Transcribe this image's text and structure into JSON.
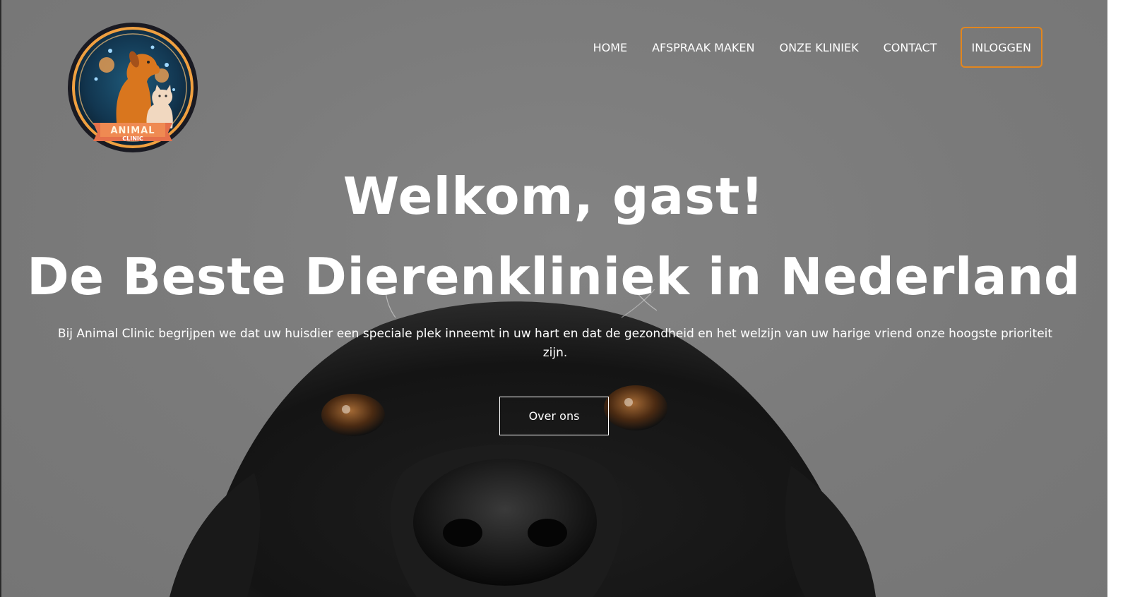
{
  "brand": {
    "logo_text_main": "ANIMAL",
    "logo_text_sub": "CLINIC"
  },
  "nav": {
    "items": [
      {
        "label": "HOME"
      },
      {
        "label": "AFSPRAAK MAKEN"
      },
      {
        "label": "ONZE KLINIEK"
      },
      {
        "label": "CONTACT"
      }
    ],
    "login_label": "INLOGGEN"
  },
  "hero": {
    "welcome": "Welkom, gast!",
    "headline": "De Beste Dierenkliniek in Nederland",
    "intro": "Bij Animal Clinic begrijpen we dat uw huisdier een speciale plek inneemt in uw hart en dat de gezondheid en het welzijn van uw harige vriend onze hoogste prioriteit zijn.",
    "button_label": "Over ons"
  },
  "colors": {
    "accent": "#e2861e",
    "overlay": "#7a7a7a",
    "text": "#ffffff"
  },
  "icons": {
    "logo": "animal-clinic-logo",
    "background": "black-dog-photo"
  }
}
